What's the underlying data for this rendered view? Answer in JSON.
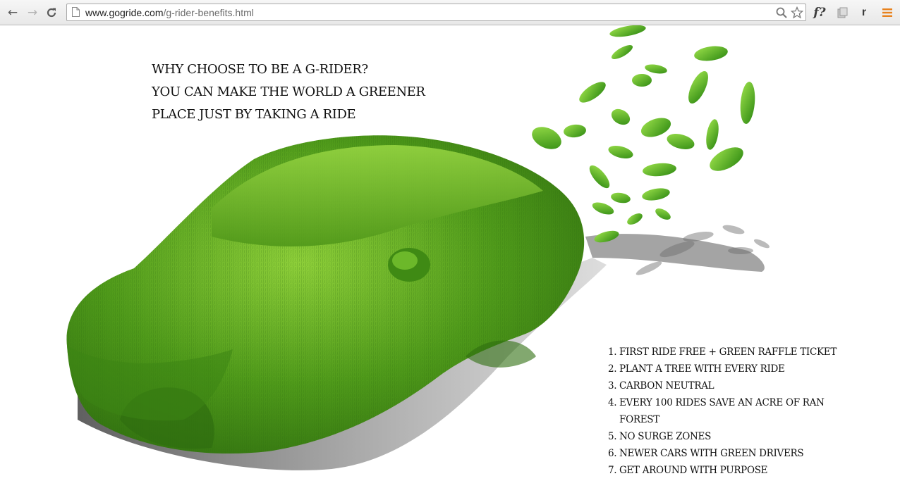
{
  "browser": {
    "url_host": "www.gogride.com",
    "url_path": "/g-rider-benefits.html",
    "extensions": {
      "font_ext_label": "f?",
      "profile_label": "r"
    },
    "icons": {
      "back": "arrow-left-icon",
      "forward": "arrow-right-icon",
      "reload": "reload-icon",
      "page": "page-icon",
      "search": "search-icon",
      "bookmark": "star-icon",
      "extension": "puzzle-icon",
      "menu": "hamburger-menu-icon"
    },
    "colors": {
      "menu_accent": "#e8821e"
    }
  },
  "page": {
    "headline": [
      "WHY CHOOSE TO BE A G-RIDER?",
      "YOU CAN MAKE THE WORLD A GREENER",
      "PLACE JUST BY TAKING A RIDE"
    ],
    "benefits": [
      {
        "num": "1.",
        "text": "FIRST RIDE FREE + GREEN RAFFLE TICKET"
      },
      {
        "num": "2.",
        "text": "PLANT A TREE WITH EVERY RIDE"
      },
      {
        "num": "3.",
        "text": "CARBON NEUTRAL"
      },
      {
        "num": "4.",
        "text": "EVERY 100 RIDES SAVE AN ACRE OF RAN FOREST"
      },
      {
        "num": "5.",
        "text": "NO SURGE ZONES"
      },
      {
        "num": "6.",
        "text": "NEWER CARS WITH GREEN DRIVERS"
      },
      {
        "num": "7.",
        "text": "GET AROUND WITH PURPOSE"
      }
    ],
    "colors": {
      "grass_dark": "#2f6e0f",
      "grass_mid": "#4f9a1a",
      "grass_light": "#8fd03a",
      "text": "#111111"
    }
  }
}
